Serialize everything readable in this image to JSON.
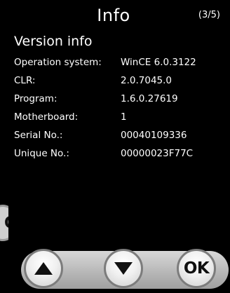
{
  "header": {
    "title": "Info",
    "page_indicator": "(3/5)"
  },
  "section": {
    "title": "Version info"
  },
  "rows": [
    {
      "label": "Operation system:",
      "value": "WinCE 6.0.3122"
    },
    {
      "label": "CLR:",
      "value": "2.0.7045.0"
    },
    {
      "label": "Program:",
      "value": "1.6.0.27619"
    },
    {
      "label": "Motherboard:",
      "value": "1"
    },
    {
      "label": "Serial No.:",
      "value": "00040109336"
    },
    {
      "label": "Unique No.:",
      "value": "00000023F77C"
    }
  ],
  "buttons": {
    "up_icon": "up-arrow-icon",
    "down_icon": "down-arrow-icon",
    "ok_label": "OK"
  },
  "background_window": {
    "button_label": "OK"
  },
  "colors": {
    "background": "#000000",
    "text": "#ffffff",
    "button_face": "#f0f0f0",
    "button_border": "#7c7c7c",
    "bar": "#b8b8b8"
  }
}
